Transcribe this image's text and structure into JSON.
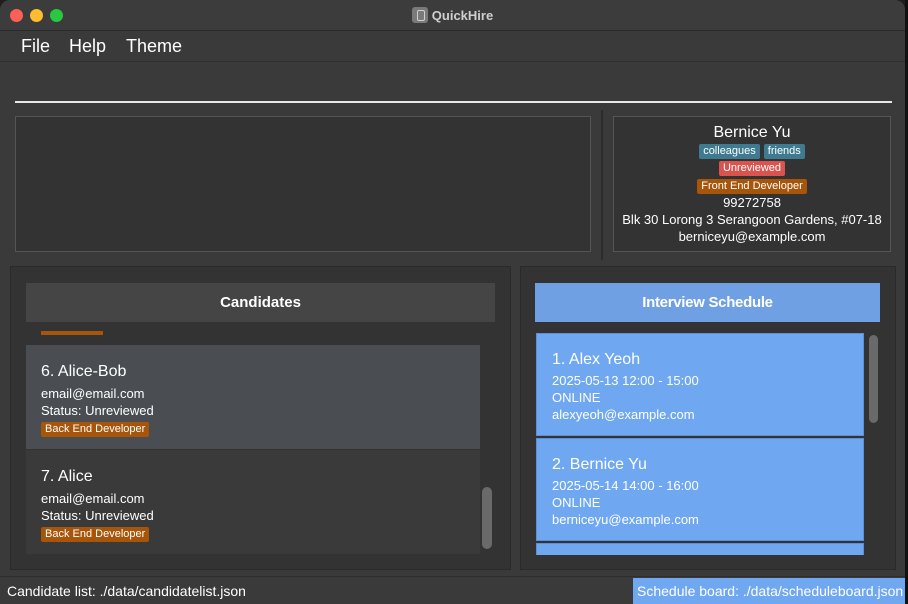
{
  "window": {
    "title": "QuickHire"
  },
  "menu": {
    "items": [
      "File",
      "Help",
      "Theme"
    ]
  },
  "command": {
    "value": "",
    "placeholder": ""
  },
  "detail": {
    "name": "Bernice Yu",
    "tags": [
      "colleagues",
      "friends"
    ],
    "status": "Unreviewed",
    "job": "Front End Developer",
    "phone": "99272758",
    "address": "Blk 30 Lorong 3 Serangoon Gardens, #07-18",
    "email": "berniceyu@example.com"
  },
  "candidates": {
    "header": "Candidates",
    "items": [
      {
        "name": "6. Alice-Bob",
        "email": "email@email.com",
        "status": "Status: Unreviewed",
        "job": "Back End Developer"
      },
      {
        "name": "7. Alice",
        "email": "email@email.com",
        "status": "Status: Unreviewed",
        "job": "Back End Developer"
      }
    ]
  },
  "schedule": {
    "header": "Interview Schedule",
    "items": [
      {
        "name": "1. Alex Yeoh",
        "datetime": "2025-05-13  12:00 - 15:00",
        "mode": "ONLINE",
        "email": "alexyeoh@example.com"
      },
      {
        "name": "2. Bernice Yu",
        "datetime": "2025-05-14  14:00 - 16:00",
        "mode": "ONLINE",
        "email": "berniceyu@example.com"
      }
    ]
  },
  "status": {
    "candidate_file": "Candidate list: ./data/candidatelist.json",
    "schedule_file": "Schedule board: ./data/scheduleboard.json"
  },
  "colors": {
    "accent_blue": "#6fa8f0",
    "tag_blue": "#3e7b91",
    "tag_red": "#d9534f",
    "tag_orange": "#a6550a"
  }
}
